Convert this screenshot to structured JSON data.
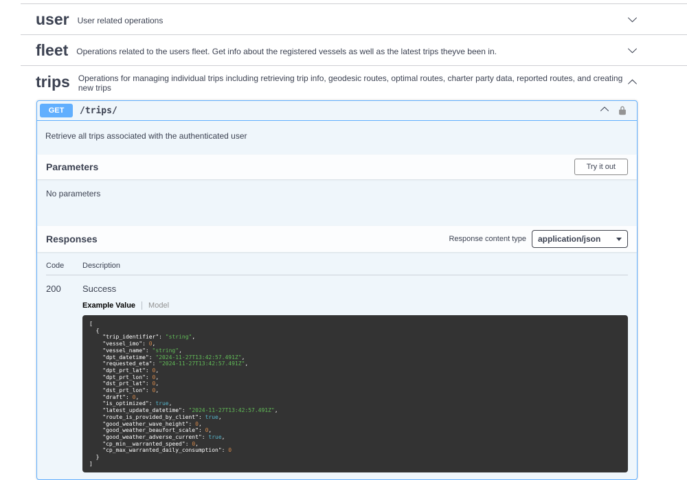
{
  "sections": [
    {
      "name": "user",
      "description": "User related operations"
    },
    {
      "name": "fleet",
      "description": "Operations related to the users fleet. Get info about the registered vessels as well as the latest trips theyve been in."
    },
    {
      "name": "trips",
      "description": "Operations for managing individual trips including retrieving trip info, geodesic routes, optimal routes, charter party data, reported routes, and creating new trips"
    }
  ],
  "operation": {
    "method": "GET",
    "path": "/trips/",
    "description": "Retrieve all trips associated with the authenticated user",
    "parameters_title": "Parameters",
    "try_it_out_label": "Try it out",
    "no_parameters_text": "No parameters",
    "responses_title": "Responses",
    "response_content_type_label": "Response content type",
    "response_content_type_value": "application/json",
    "table": {
      "code_header": "Code",
      "description_header": "Description"
    },
    "response": {
      "code": "200",
      "description": "Success"
    },
    "tabs": {
      "example": "Example Value",
      "model": "Model"
    },
    "example_lines": [
      "[",
      "  {",
      "    \"trip_identifier\": \"string\",",
      "    \"vessel_imo\": 0,",
      "    \"vessel_name\": \"string\",",
      "    \"dpt_datetime\": \"2024-11-27T13:42:57.491Z\",",
      "    \"requested_eta\": \"2024-11-27T13:42:57.491Z\",",
      "    \"dpt_prt_lat\": 0,",
      "    \"dpt_prt_lon\": 0,",
      "    \"dst_prt_lat\": 0,",
      "    \"dst_prt_lon\": 0,",
      "    \"draft\": 0,",
      "    \"is_optimized\": true,",
      "    \"latest_update_datetime\": \"2024-11-27T13:42:57.491Z\",",
      "    \"route_is_provided_by_client\": true,",
      "    \"good_weather_wave_height\": 0,",
      "    \"good_weather_beaufort_scale\": 0,",
      "    \"good_weather_adverse_current\": true,",
      "    \"cp_min__warranted_speed\": 0,",
      "    \"cp_max_warranted_daily_consumption\": 0",
      "  }",
      "]"
    ]
  },
  "colors": {
    "method_get": "#61affe",
    "opblock_background": "#eff6fb",
    "code_background": "#333333",
    "string_token": "#62bd58",
    "number_token": "#d0874c",
    "boolean_token": "#56b3c9"
  }
}
